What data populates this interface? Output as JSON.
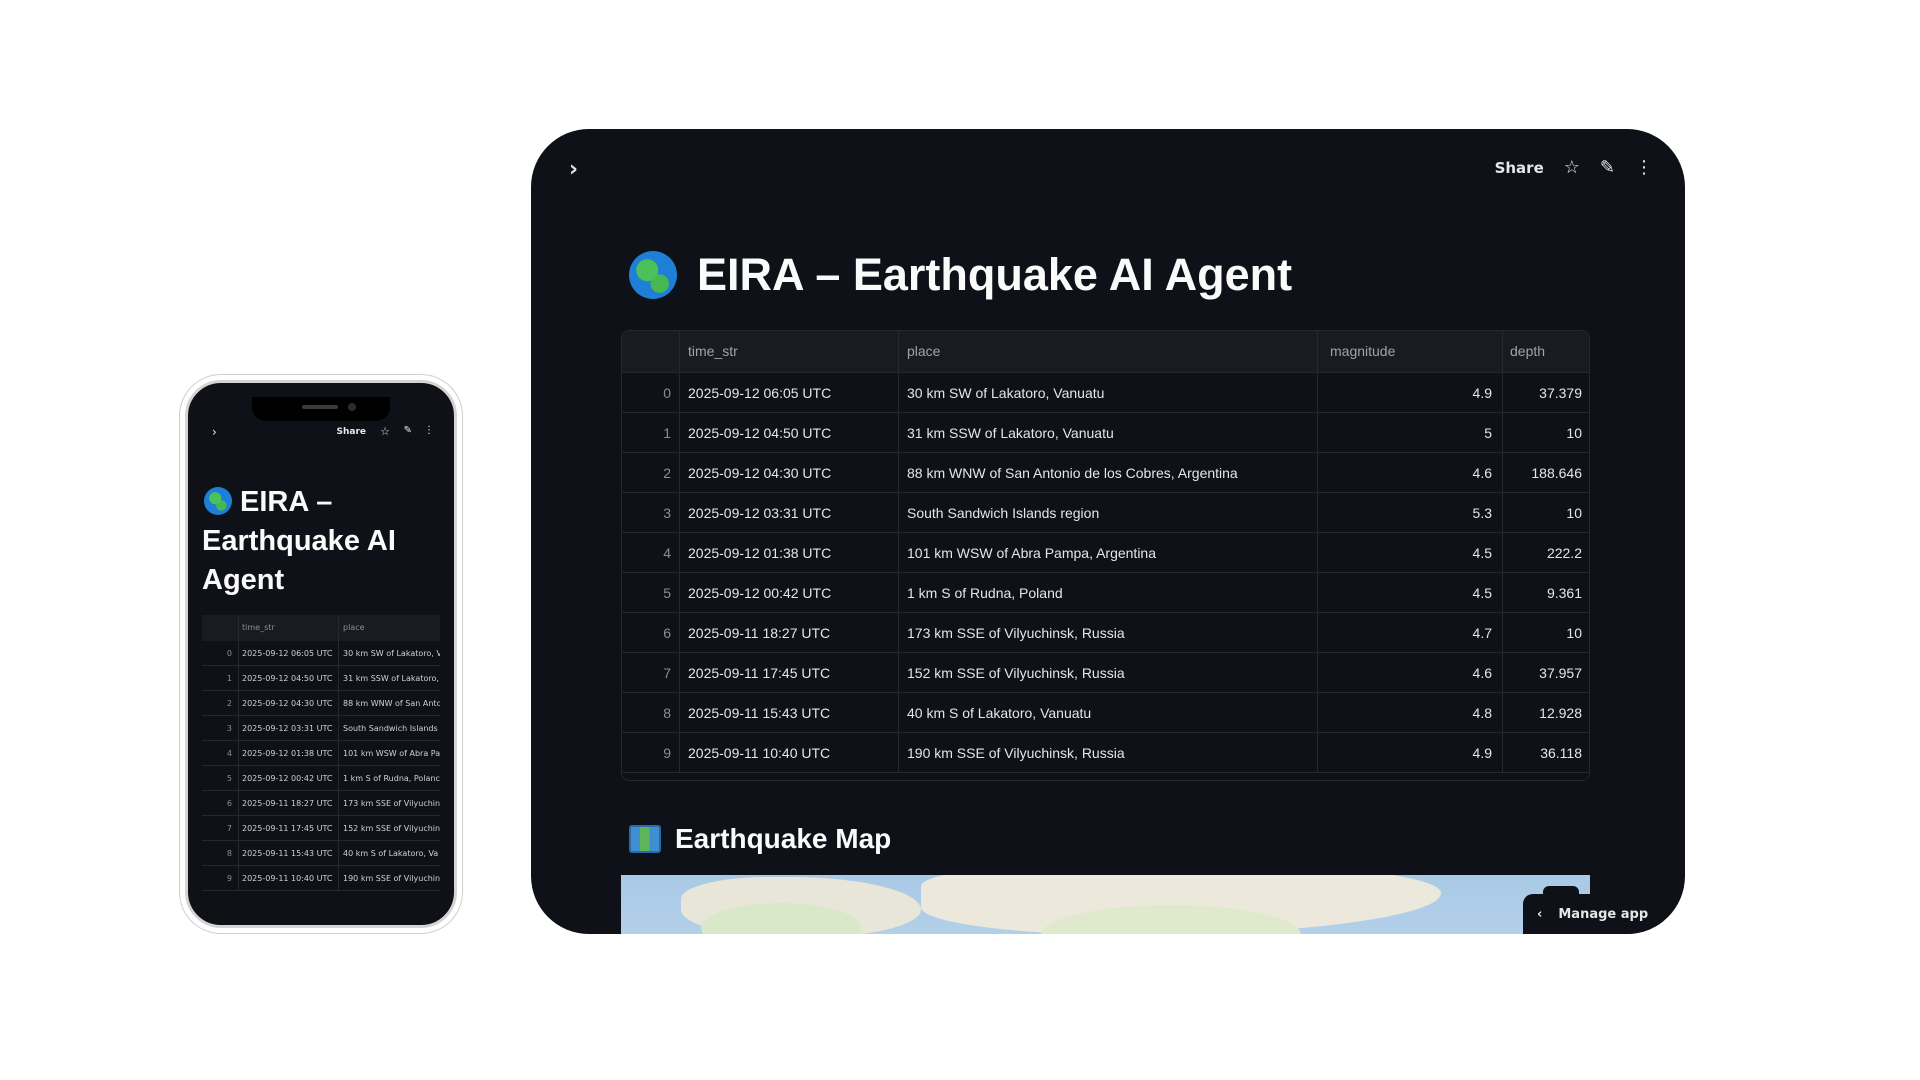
{
  "app": {
    "title": "EIRA – Earthquake AI Agent",
    "toolbar": {
      "share_label": "Share"
    },
    "section_map_title": "Earthquake Map",
    "manage_label": "Manage app"
  },
  "table": {
    "columns": [
      "time_str",
      "place",
      "magnitude",
      "depth"
    ],
    "rows": [
      {
        "index": "0",
        "time_str": "2025-09-12 06:05 UTC",
        "place": "30 km SW of Lakatoro, Vanuatu",
        "magnitude": "4.9",
        "depth": "37.379"
      },
      {
        "index": "1",
        "time_str": "2025-09-12 04:50 UTC",
        "place": "31 km SSW of Lakatoro, Vanuatu",
        "magnitude": "5",
        "depth": "10"
      },
      {
        "index": "2",
        "time_str": "2025-09-12 04:30 UTC",
        "place": "88 km WNW of San Antonio de los Cobres, Argentina",
        "magnitude": "4.6",
        "depth": "188.646"
      },
      {
        "index": "3",
        "time_str": "2025-09-12 03:31 UTC",
        "place": "South Sandwich Islands region",
        "magnitude": "5.3",
        "depth": "10"
      },
      {
        "index": "4",
        "time_str": "2025-09-12 01:38 UTC",
        "place": "101 km WSW of Abra Pampa, Argentina",
        "magnitude": "4.5",
        "depth": "222.2"
      },
      {
        "index": "5",
        "time_str": "2025-09-12 00:42 UTC",
        "place": "1 km S of Rudna, Poland",
        "magnitude": "4.5",
        "depth": "9.361"
      },
      {
        "index": "6",
        "time_str": "2025-09-11 18:27 UTC",
        "place": "173 km SSE of Vilyuchinsk, Russia",
        "magnitude": "4.7",
        "depth": "10"
      },
      {
        "index": "7",
        "time_str": "2025-09-11 17:45 UTC",
        "place": "152 km SSE of Vilyuchinsk, Russia",
        "magnitude": "4.6",
        "depth": "37.957"
      },
      {
        "index": "8",
        "time_str": "2025-09-11 15:43 UTC",
        "place": "40 km S of Lakatoro, Vanuatu",
        "magnitude": "4.8",
        "depth": "12.928"
      },
      {
        "index": "9",
        "time_str": "2025-09-11 10:40 UTC",
        "place": "190 km SSE of Vilyuchinsk, Russia",
        "magnitude": "4.9",
        "depth": "36.118"
      }
    ]
  },
  "phone": {
    "title_line1": "EIRA –",
    "title_line2": "Earthquake AI",
    "title_line3": "Agent",
    "rows": [
      {
        "index": "0",
        "time_str": "2025-09-12 06:05 UTC",
        "place": "30 km SW of Lakatoro, V"
      },
      {
        "index": "1",
        "time_str": "2025-09-12 04:50 UTC",
        "place": "31 km SSW of Lakatoro,"
      },
      {
        "index": "2",
        "time_str": "2025-09-12 04:30 UTC",
        "place": "88 km WNW of San Anto"
      },
      {
        "index": "3",
        "time_str": "2025-09-12 03:31 UTC",
        "place": "South Sandwich Islands"
      },
      {
        "index": "4",
        "time_str": "2025-09-12 01:38 UTC",
        "place": "101 km WSW of Abra Pa"
      },
      {
        "index": "5",
        "time_str": "2025-09-12 00:42 UTC",
        "place": "1 km S of Rudna, Polanc"
      },
      {
        "index": "6",
        "time_str": "2025-09-11 18:27 UTC",
        "place": "173 km SSE of Vilyuchin"
      },
      {
        "index": "7",
        "time_str": "2025-09-11 17:45 UTC",
        "place": "152 km SSE of Vilyuchin"
      },
      {
        "index": "8",
        "time_str": "2025-09-11 15:43 UTC",
        "place": "40 km S of Lakatoro, Va"
      },
      {
        "index": "9",
        "time_str": "2025-09-11 10:40 UTC",
        "place": "190 km SSE of Vilyuchin"
      }
    ]
  },
  "icons": {
    "sidebar_toggle": "chevron-right-icon",
    "star": "star-icon",
    "edit": "pencil-icon",
    "menu": "more-vertical-icon",
    "title": "globe-icon",
    "map_section": "map-icon",
    "manage_chevron": "chevron-left-icon"
  },
  "colors": {
    "background": "#0e1117",
    "text": "#fafafa",
    "grid_border": "#262830",
    "header_bg": "#191b22"
  }
}
